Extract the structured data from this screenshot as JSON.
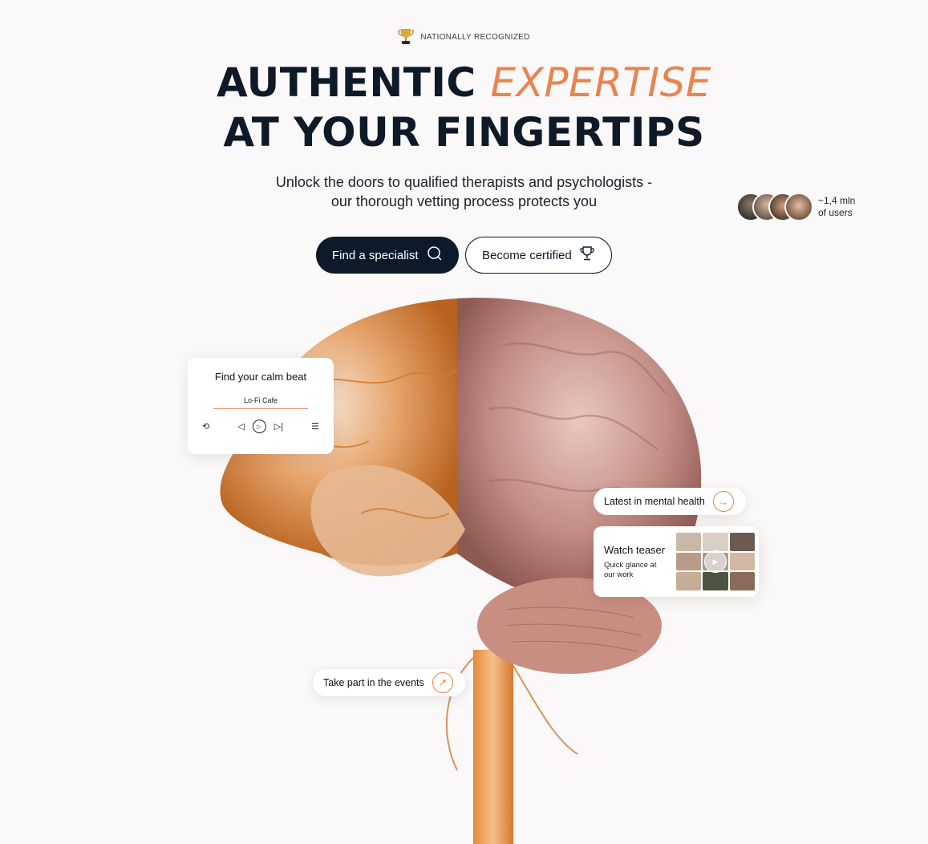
{
  "badge": {
    "text": "NATIONALLY RECOGNIZED",
    "icon": "trophy-icon"
  },
  "hero": {
    "line1_plain": "AUTHENTIC",
    "line1_accent": "EXPERTISE",
    "line2": "AT YOUR FINGERTIPS",
    "subtitle_line1": "Unlock the doors to qualified therapists and psychologists -",
    "subtitle_line2": "our thorough vetting process protects you"
  },
  "users": {
    "count_text": "~1,4 mln",
    "label": "of users"
  },
  "buttons": {
    "primary": {
      "label": "Find a specialist",
      "icon": "search-icon"
    },
    "secondary": {
      "label": "Become certified",
      "icon": "trophy-icon"
    }
  },
  "music": {
    "title": "Find your calm beat",
    "track": "Lo-Fi Cafe",
    "controls": [
      "repeat-icon",
      "previous-icon",
      "play-icon",
      "next-icon",
      "playlist-icon"
    ]
  },
  "news": {
    "label": "Latest in mental health",
    "icon": "arrow-right-icon"
  },
  "teaser": {
    "title": "Watch teaser",
    "subtitle": "Quick glance at our work"
  },
  "events": {
    "label": "Take part in the events",
    "icon": "arrow-up-right-icon"
  },
  "colors": {
    "navy": "#0c1a2a",
    "accent": "#e8844f",
    "background": "#faf8f8"
  }
}
